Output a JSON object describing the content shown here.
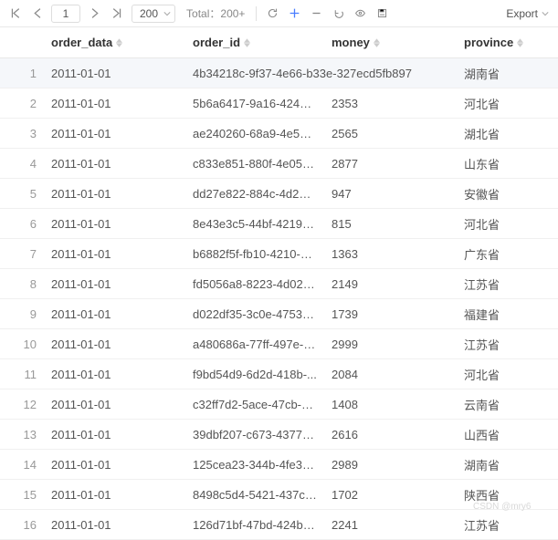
{
  "toolbar": {
    "page_current": "1",
    "page_size": "200",
    "total_label": "Total：",
    "total_value": "200+",
    "export_label": "Export"
  },
  "columns": {
    "order_data": "order_data",
    "order_id": "order_id",
    "money": "money",
    "province": "province"
  },
  "selected_cell": "4b34218c-9f37-4e66-b33e-327ecd5fb897",
  "rows": [
    {
      "idx": "1",
      "order_data": "2011-01-01",
      "order_id": "4b34218c-9f37-4e66-b33e-327ecd5fb897",
      "money": "",
      "province": "湖南省"
    },
    {
      "idx": "2",
      "order_data": "2011-01-01",
      "order_id": "5b6a6417-9a16-4243-9...",
      "money": "2353",
      "province": "河北省"
    },
    {
      "idx": "3",
      "order_data": "2011-01-01",
      "order_id": "ae240260-68a9-4e59-b...",
      "money": "2565",
      "province": "湖北省"
    },
    {
      "idx": "4",
      "order_data": "2011-01-01",
      "order_id": "c833e851-880f-4e05-9...",
      "money": "2877",
      "province": "山东省"
    },
    {
      "idx": "5",
      "order_data": "2011-01-01",
      "order_id": "dd27e822-884c-4d20-...",
      "money": "947",
      "province": "安徽省"
    },
    {
      "idx": "6",
      "order_data": "2011-01-01",
      "order_id": "8e43e3c5-44bf-4219-8...",
      "money": "815",
      "province": "河北省"
    },
    {
      "idx": "7",
      "order_data": "2011-01-01",
      "order_id": "b6882f5f-fb10-4210-9e...",
      "money": "1363",
      "province": "广东省"
    },
    {
      "idx": "8",
      "order_data": "2011-01-01",
      "order_id": "fd5056a8-8223-4d02-9...",
      "money": "2149",
      "province": "江苏省"
    },
    {
      "idx": "9",
      "order_data": "2011-01-01",
      "order_id": "d022df35-3c0e-4753-b...",
      "money": "1739",
      "province": "福建省"
    },
    {
      "idx": "10",
      "order_data": "2011-01-01",
      "order_id": "a480686a-77ff-497e-9e...",
      "money": "2999",
      "province": "江苏省"
    },
    {
      "idx": "11",
      "order_data": "2011-01-01",
      "order_id": "f9bd54d9-6d2d-418b-...",
      "money": "2084",
      "province": "河北省"
    },
    {
      "idx": "12",
      "order_data": "2011-01-01",
      "order_id": "c32ff7d2-5ace-47cb-82...",
      "money": "1408",
      "province": "云南省"
    },
    {
      "idx": "13",
      "order_data": "2011-01-01",
      "order_id": "39dbf207-c673-4377-b...",
      "money": "2616",
      "province": "山西省"
    },
    {
      "idx": "14",
      "order_data": "2011-01-01",
      "order_id": "125cea23-344b-4fe3-a...",
      "money": "2989",
      "province": "湖南省"
    },
    {
      "idx": "15",
      "order_data": "2011-01-01",
      "order_id": "8498c5d4-5421-437c-a...",
      "money": "1702",
      "province": "陕西省"
    },
    {
      "idx": "16",
      "order_data": "2011-01-01",
      "order_id": "126d71bf-47bd-424b-a...",
      "money": "2241",
      "province": "江苏省"
    }
  ],
  "watermark": "CSDN @mry6"
}
